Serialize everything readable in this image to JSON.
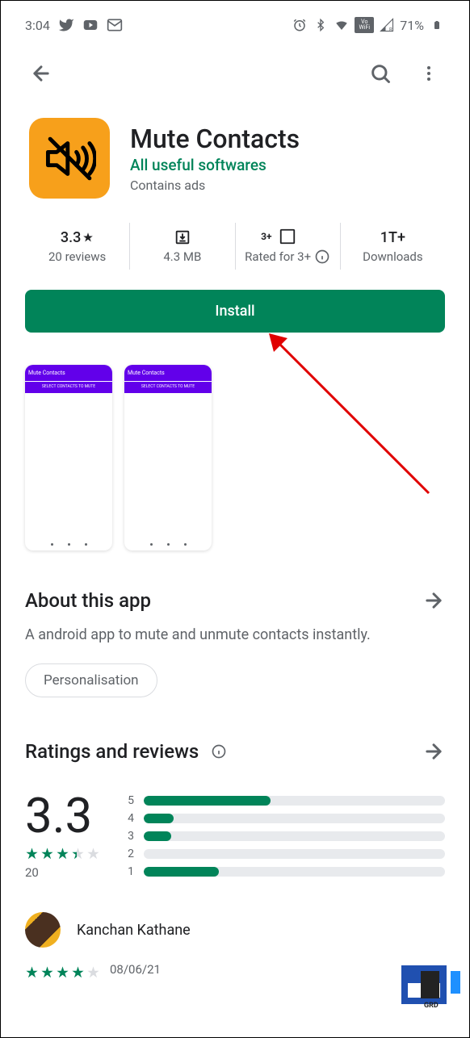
{
  "status_bar": {
    "time": "3:04",
    "battery_pct": "71%"
  },
  "app": {
    "title": "Mute Contacts",
    "developer": "All useful softwares",
    "ads_notice": "Contains ads",
    "icon_color": "#f7a01b"
  },
  "stats": {
    "rating_value": "3.3",
    "rating_label": "20 reviews",
    "size_value": "",
    "size_label": "4.3 MB",
    "content_rating_value": "3+",
    "content_rating_label": "Rated for 3+",
    "downloads_value": "1T+",
    "downloads_label": "Downloads"
  },
  "install_button_label": "Install",
  "screenshots": {
    "title": "Mute Contacts",
    "subtitle": "SELECT CONTACTS TO MUTE"
  },
  "about": {
    "header": "About this app",
    "description": "A android app to mute and unmute contacts instantly.",
    "tag": "Personalisation"
  },
  "ratings": {
    "header": "Ratings and reviews",
    "overall": "3.3",
    "count": "20",
    "distribution": [
      {
        "label": "5",
        "pct": 42
      },
      {
        "label": "4",
        "pct": 10
      },
      {
        "label": "3",
        "pct": 9
      },
      {
        "label": "2",
        "pct": 0
      },
      {
        "label": "1",
        "pct": 25
      }
    ]
  },
  "review": {
    "name": "Kanchan Kathane",
    "date": "08/06/21",
    "stars": 4
  }
}
